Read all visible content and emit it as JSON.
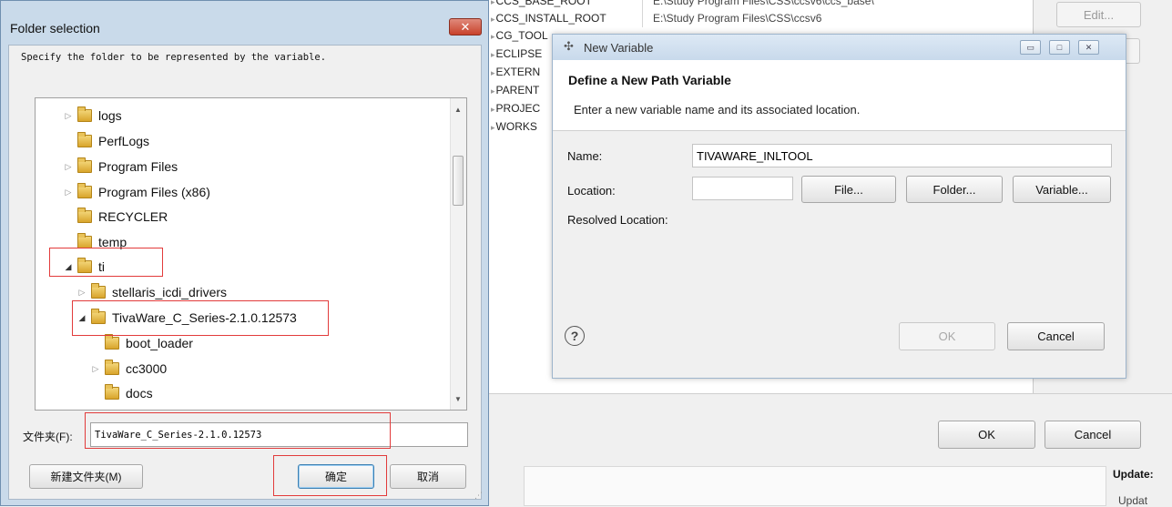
{
  "background_window": {
    "variables": [
      {
        "name": "CCS_BASE_ROOT",
        "value": "E:\\Study Program Files\\CSS\\ccsv6\\ccs_base\\"
      },
      {
        "name": "CCS_INSTALL_ROOT",
        "value": "E:\\Study Program Files\\CSS\\ccsv6"
      },
      {
        "name": "CG_TOOL"
      },
      {
        "name": "ECLIPSE"
      },
      {
        "name": "EXTERN"
      },
      {
        "name": "PARENT"
      },
      {
        "name": "PROJEC"
      },
      {
        "name": "WORKS"
      }
    ],
    "edit_label": "Edit...",
    "ok_label": "OK",
    "cancel_label": "Cancel",
    "update_heading": "Update:",
    "update_text": "Updat"
  },
  "folder_dialog": {
    "title": "Folder selection",
    "instruction": "Specify the folder to be represented by the variable.",
    "tree": [
      {
        "label": "logs",
        "level": 0,
        "expander": "collapsed"
      },
      {
        "label": "PerfLogs",
        "level": 0,
        "expander": "none"
      },
      {
        "label": "Program Files",
        "level": 0,
        "expander": "collapsed"
      },
      {
        "label": "Program Files (x86)",
        "level": 0,
        "expander": "collapsed"
      },
      {
        "label": "RECYCLER",
        "level": 0,
        "expander": "none"
      },
      {
        "label": "temp",
        "level": 0,
        "expander": "none"
      },
      {
        "label": "ti",
        "level": 0,
        "expander": "expanded",
        "highlighted": true
      },
      {
        "label": "stellaris_icdi_drivers",
        "level": 1,
        "expander": "collapsed"
      },
      {
        "label": "TivaWare_C_Series-2.1.0.12573",
        "level": 1,
        "expander": "expanded",
        "highlighted": true
      },
      {
        "label": "boot_loader",
        "level": 2,
        "expander": "none"
      },
      {
        "label": "cc3000",
        "level": 2,
        "expander": "collapsed"
      },
      {
        "label": "docs",
        "level": 2,
        "expander": "none"
      }
    ],
    "folder_label": "文件夹(F):",
    "folder_value": "TivaWare_C_Series-2.1.0.12573",
    "new_folder_label": "新建文件夹(M)",
    "ok_label": "确定",
    "cancel_label": "取消",
    "highlight_color": "#e23b3b"
  },
  "new_variable_dialog": {
    "title": "New Variable",
    "heading": "Define a New Path Variable",
    "description": "Enter a new variable name and its associated location.",
    "name_label": "Name:",
    "name_value": "TIVAWARE_INLTOOL",
    "location_label": "Location:",
    "location_value": "",
    "resolved_label": "Resolved Location:",
    "file_button": "File...",
    "folder_button": "Folder...",
    "variable_button": "Variable...",
    "ok_label": "OK",
    "cancel_label": "Cancel",
    "help_icon": "?"
  }
}
